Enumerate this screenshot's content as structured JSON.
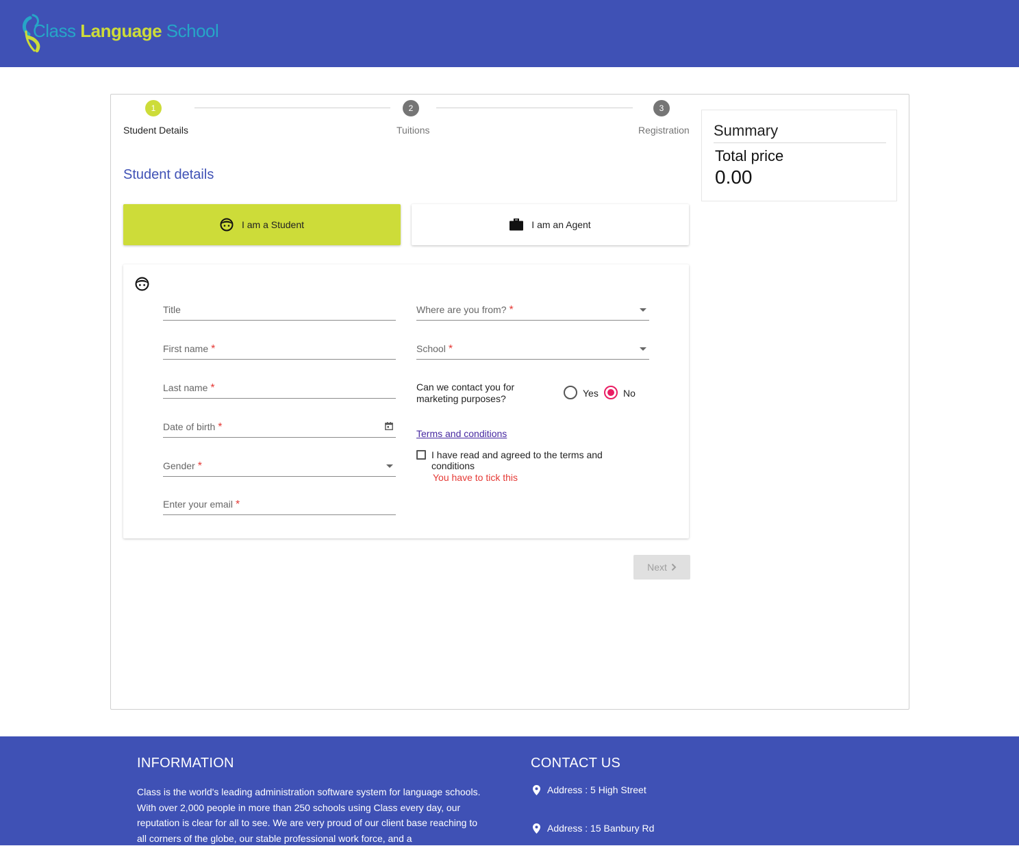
{
  "header": {
    "logo": {
      "word1": "Class",
      "word2": "Language",
      "word3": "School"
    }
  },
  "stepper": {
    "steps": [
      {
        "number": "1",
        "label": "Student Details",
        "state": "active"
      },
      {
        "number": "2",
        "label": "Tuitions",
        "state": "inactive"
      },
      {
        "number": "3",
        "label": "Registration",
        "state": "inactive"
      }
    ]
  },
  "main": {
    "section_title": "Student details",
    "role_buttons": {
      "student_label": "I am a Student",
      "agent_label": "I am an Agent"
    },
    "form": {
      "left_fields": {
        "title": "Title",
        "first_name": "First name",
        "last_name": "Last name",
        "dob": "Date of birth",
        "gender": "Gender",
        "email": "Enter your email"
      },
      "required_mark": "*",
      "right_fields": {
        "where_from": "Where are you from?",
        "school": "School"
      },
      "marketing": {
        "question": "Can we contact you for marketing purposes?",
        "yes_label": "Yes",
        "no_label": "No",
        "selected": "No"
      },
      "terms": {
        "link_text": "Terms and conditions",
        "agree_text": "I have read and agreed to the terms and conditions",
        "error_text": "You have to tick this",
        "checked": false
      }
    },
    "next_label": "Next"
  },
  "summary": {
    "title": "Summary",
    "total_label": "Total price",
    "total_value": "0.00"
  },
  "footer": {
    "info_title": "INFORMATION",
    "info_text": "Class is the world's leading administration software system for language schools. With over 2,000 people in more than 250 schools using Class every day, our reputation is clear for all to see. We are very proud of our client base reaching to all corners of the globe, our stable professional work force, and a",
    "contact_title": "CONTACT US",
    "addresses": [
      "Address : 5 High Street",
      "Address : 15 Banbury Rd"
    ]
  },
  "colors": {
    "primary": "#3f51b5",
    "accent": "#cddc39",
    "error": "#e53935",
    "radio_checked": "#e91e63"
  },
  "icons": {
    "student": "student-face-icon",
    "agent": "briefcase-icon",
    "calendar": "calendar-icon",
    "next": "chevron-right-icon",
    "address": "location-pin-icon"
  }
}
